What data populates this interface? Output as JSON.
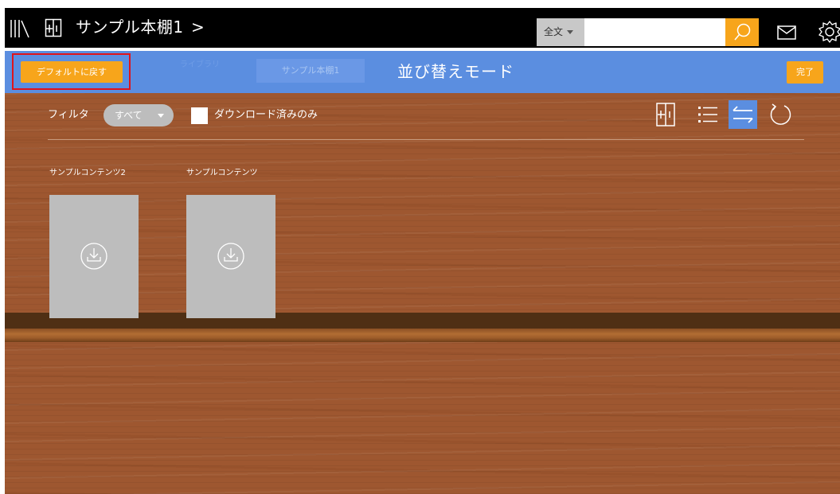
{
  "header": {
    "shelf_title": "サンプル本棚1",
    "chevron": ">",
    "icons": [
      "library-icon",
      "bookshelf-icon",
      "search-icon",
      "mail-icon",
      "gear-icon"
    ]
  },
  "search": {
    "scope": "全文",
    "value": "",
    "placeholder": ""
  },
  "modebar": {
    "reset_label": "デフォルトに戻す",
    "ghost_tab_label": "ライブラリ",
    "current_tab_label": "サンプル本棚1",
    "mode_title": "並び替えモード",
    "done_label": "完了"
  },
  "filter": {
    "label": "フィルタ",
    "selected": "すべて",
    "downloaded_only_label": "ダウンロード済みのみ",
    "downloaded_only_checked": false,
    "toolbar_icons": [
      "add-shelf-icon",
      "list-view-icon",
      "sort-icon",
      "refresh-icon"
    ]
  },
  "books": [
    {
      "title": "サンプルコンテンツ2"
    },
    {
      "title": "サンプルコンテンツ"
    }
  ],
  "colors": {
    "topbar": "#000000",
    "modebar": "#5b8ee0",
    "accent_orange": "#f7a51b",
    "wood": "#9e5730",
    "highlight": "#e0141b"
  }
}
